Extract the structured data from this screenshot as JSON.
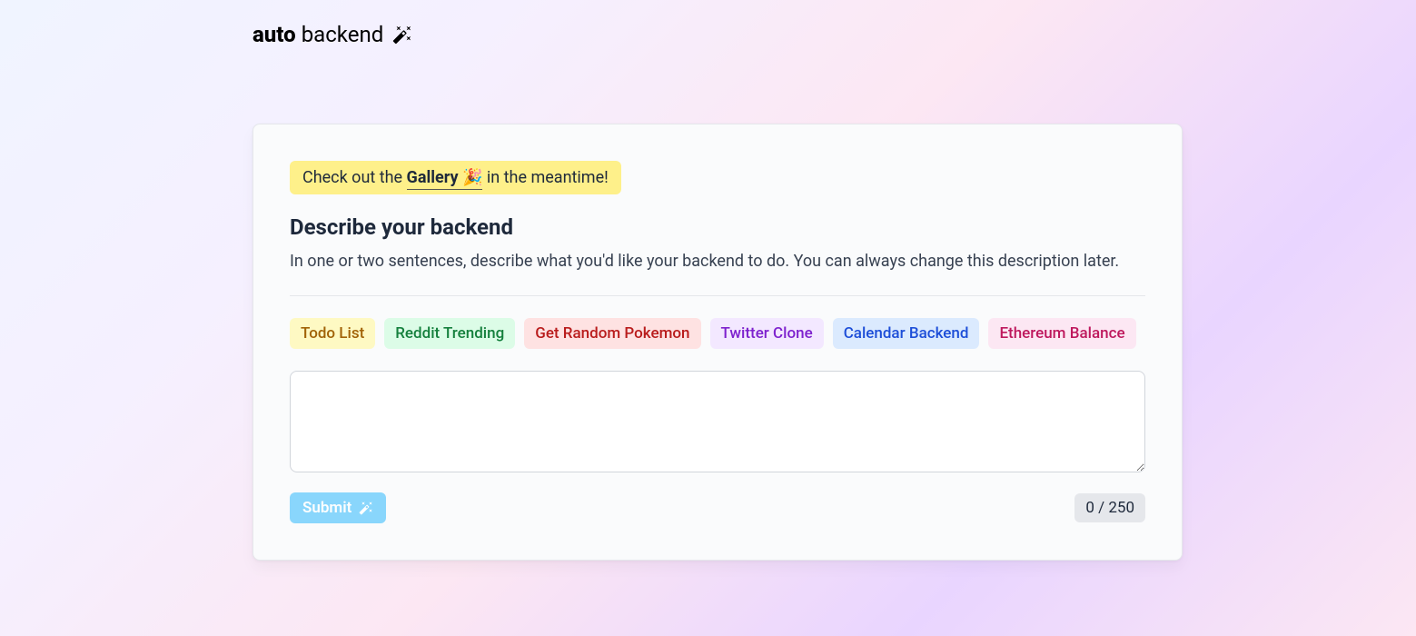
{
  "logo": {
    "bold": "auto",
    "normal": "backend"
  },
  "banner": {
    "prefix": "Check out the ",
    "link": "Gallery 🎉",
    "suffix": " in the meantime!"
  },
  "heading": "Describe your backend",
  "subheading": "In one or two sentences, describe what you'd like your backend to do. You can always change this description later.",
  "chips": [
    {
      "label": "Todo List",
      "color": "yellow"
    },
    {
      "label": "Reddit Trending",
      "color": "green"
    },
    {
      "label": "Get Random Pokemon",
      "color": "red"
    },
    {
      "label": "Twitter Clone",
      "color": "purple"
    },
    {
      "label": "Calendar Backend",
      "color": "blue"
    },
    {
      "label": "Ethereum Balance",
      "color": "pink"
    }
  ],
  "textarea": {
    "value": "",
    "placeholder": ""
  },
  "submit": {
    "label": "Submit"
  },
  "counter": {
    "current": 0,
    "max": 250,
    "display": "0 / 250"
  }
}
